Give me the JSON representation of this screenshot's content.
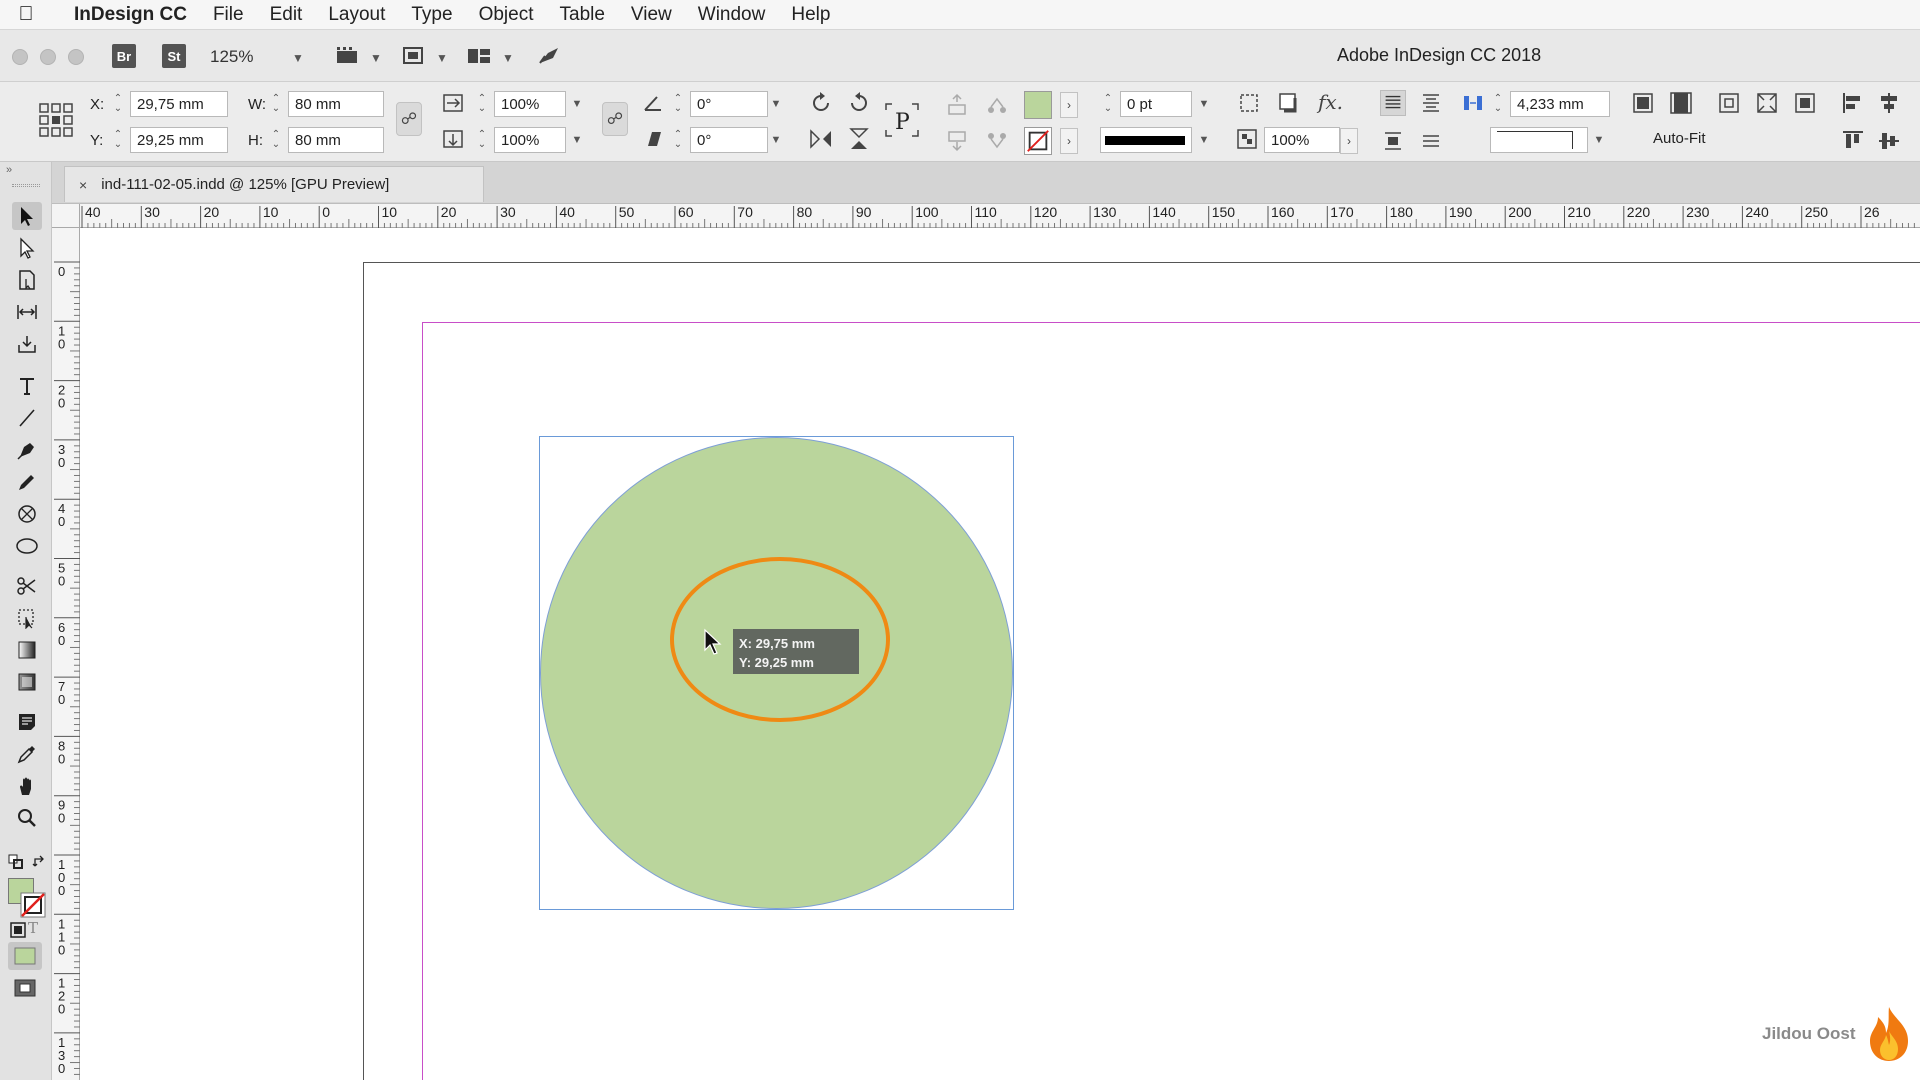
{
  "menubar": {
    "app_name": "InDesign CC",
    "items": [
      "File",
      "Edit",
      "Layout",
      "Type",
      "Object",
      "Table",
      "View",
      "Window",
      "Help"
    ]
  },
  "appbar": {
    "bridge_label": "Br",
    "stock_label": "St",
    "zoom": "125%",
    "title": "Adobe InDesign CC 2018"
  },
  "control": {
    "x_label": "X:",
    "y_label": "Y:",
    "x_value": "29,75 mm",
    "y_value": "29,25 mm",
    "w_label": "W:",
    "h_label": "H:",
    "w_value": "80 mm",
    "h_value": "80 mm",
    "scale_x": "100%",
    "scale_y": "100%",
    "rotation": "0°",
    "shear": "0°",
    "stroke_weight": "0 pt",
    "opacity": "100%",
    "column_value": "4,233 mm",
    "autofit_label": "Auto-Fit",
    "fill_color": "#bad59c",
    "stroke_color": "none"
  },
  "tab": {
    "close": "×",
    "title": "ind-111-02-05.indd @ 125% [GPU Preview]"
  },
  "rulers": {
    "horizontal": [
      "40",
      "30",
      "20",
      "10",
      "0",
      "10",
      "20",
      "30",
      "40",
      "50",
      "60",
      "70",
      "80",
      "90",
      "100",
      "110",
      "120",
      "130",
      "140",
      "150",
      "160",
      "170",
      "180",
      "190",
      "200",
      "210",
      "220",
      "230",
      "240",
      "250",
      "26"
    ],
    "vertical": [
      "0",
      "1\n0",
      "2\n0",
      "3\n0",
      "4\n0",
      "5\n0",
      "6\n0",
      "7\n0",
      "8\n0",
      "9\n0",
      "1\n0\n0",
      "1\n1\n0",
      "1\n2\n0",
      "1\n3\n0"
    ]
  },
  "canvas": {
    "tooltip_x": "X: 29,75 mm",
    "tooltip_y": "Y: 29,25 mm",
    "circle_fill": "#bad59c",
    "ellipse_stroke": "#ef8a14"
  },
  "watermark": {
    "text": "Jildou Oost"
  }
}
